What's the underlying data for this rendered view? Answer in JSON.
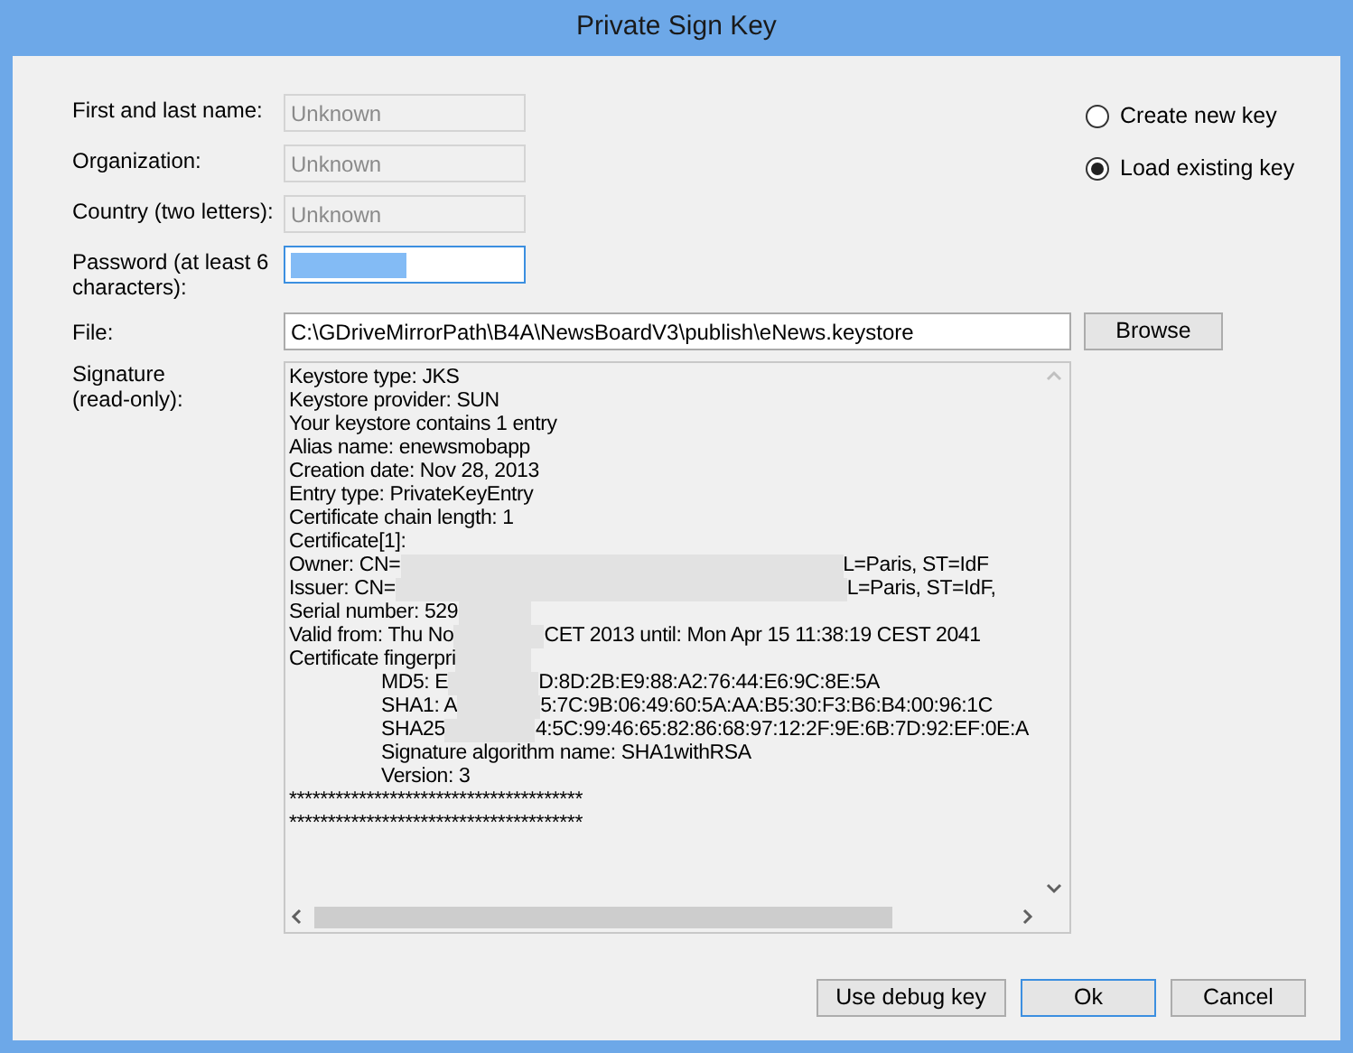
{
  "window": {
    "title": "Private Sign Key"
  },
  "fields": [
    {
      "label": "First and last name:",
      "value": "Unknown",
      "disabled": true
    },
    {
      "label": "Organization:",
      "value": "Unknown",
      "disabled": true
    },
    {
      "label": "Country (two letters):",
      "value": "Unknown",
      "disabled": true
    },
    {
      "label": "Password (at least 6 characters):",
      "kind": "password",
      "disabled": false,
      "focused": true
    }
  ],
  "options": [
    {
      "label": "Create new key",
      "selected": false
    },
    {
      "label": "Load existing key",
      "selected": true
    }
  ],
  "file": {
    "label": "File:",
    "value": "C:\\GDriveMirrorPath\\B4A\\NewsBoardV3\\publish\\eNews.keystore",
    "button": "Browse"
  },
  "signature": {
    "label": "Signature (read-only):",
    "lines": [
      [
        {
          "text": "Keystore type: JKS"
        }
      ],
      [
        {
          "text": "Keystore provider: SUN"
        }
      ],
      [
        {
          "text": "Your keystore contains 1 entry"
        }
      ],
      [
        {
          "text": "Alias name: enewsmobapp"
        }
      ],
      [
        {
          "text": "Creation date: Nov 28, 2013"
        }
      ],
      [
        {
          "text": "Entry type: PrivateKeyEntry"
        }
      ],
      [
        {
          "text": "Certificate chain length: 1"
        }
      ],
      [
        {
          "text": "Certificate[1]:"
        }
      ],
      [
        {
          "text": "Owner: CN="
        },
        {
          "kind": "redacted"
        },
        {
          "text": "L=Paris, ST=IdF"
        }
      ],
      [
        {
          "text": "Issuer: CN="
        },
        {
          "kind": "redacted"
        },
        {
          "text": "L=Paris, ST=IdF,"
        }
      ],
      [
        {
          "text": "Serial number: 529"
        },
        {
          "kind": "redacted"
        }
      ],
      [
        {
          "text": "Valid from: Thu No"
        },
        {
          "kind": "redacted"
        },
        {
          "text": "CET 2013 until: Mon Apr 15 11:38:19 CEST 2041"
        }
      ],
      [
        {
          "text": "Certificate fingerpri"
        },
        {
          "kind": "redacted"
        }
      ],
      [
        {
          "kind": "indent"
        },
        {
          "text": "MD5:  E"
        },
        {
          "kind": "redacted"
        },
        {
          "text": "D:8D:2B:E9:88:A2:76:44:E6:9C:8E:5A"
        }
      ],
      [
        {
          "kind": "indent"
        },
        {
          "text": "SHA1: A"
        },
        {
          "kind": "redacted"
        },
        {
          "text": "5:7C:9B:06:49:60:5A:AA:B5:30:F3:B6:B4:00:96:1C"
        }
      ],
      [
        {
          "kind": "indent"
        },
        {
          "text": "SHA25"
        },
        {
          "kind": "redacted"
        },
        {
          "text": "4:5C:99:46:65:82:86:68:97:12:2F:9E:6B:7D:92:EF:0E:A"
        }
      ],
      [
        {
          "kind": "indent"
        },
        {
          "text": "Signature algorithm name: SHA1withRSA"
        }
      ],
      [
        {
          "kind": "indent"
        },
        {
          "text": "Version: 3"
        }
      ],
      [
        {
          "text": "**************************************"
        }
      ],
      [
        {
          "text": "**************************************"
        }
      ]
    ]
  },
  "buttons": [
    {
      "label": "Use debug key",
      "default": false
    },
    {
      "label": "Ok",
      "default": true
    },
    {
      "label": "Cancel",
      "default": false
    }
  ]
}
